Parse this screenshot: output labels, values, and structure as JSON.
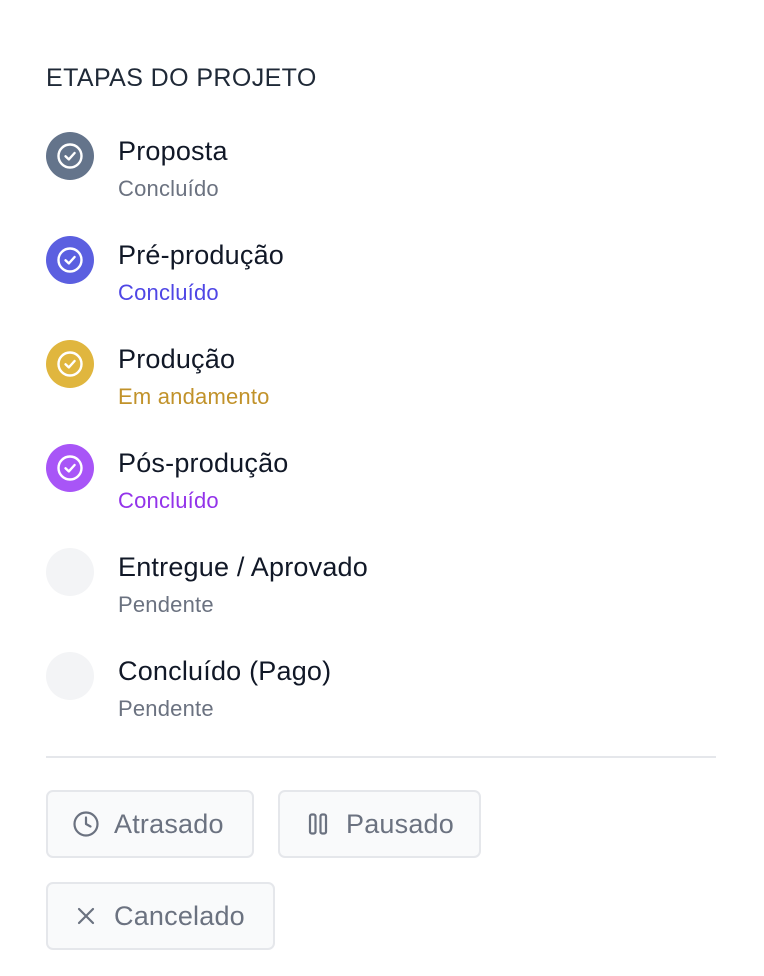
{
  "heading": "ETAPAS DO PROJETO",
  "steps": [
    {
      "title": "Proposta",
      "status": "Concluído",
      "icon": "check-circle-icon",
      "circle_color": "#64748b",
      "status_color": "#6b7280",
      "done": true
    },
    {
      "title": "Pré-produção",
      "status": "Concluído",
      "icon": "check-circle-icon",
      "circle_color": "#5b5fe0",
      "status_color": "#4f46e5",
      "done": true
    },
    {
      "title": "Produção",
      "status": "Em andamento",
      "icon": "check-circle-icon",
      "circle_color": "#e0b63e",
      "status_color": "#c1922a",
      "done": true
    },
    {
      "title": "Pós-produção",
      "status": "Concluído",
      "icon": "check-circle-icon",
      "circle_color": "#a855f7",
      "status_color": "#9333ea",
      "done": true
    },
    {
      "title": "Entregue / Aprovado",
      "status": "Pendente",
      "icon": "",
      "circle_color": "#f3f4f6",
      "status_color": "#6b7280",
      "done": false
    },
    {
      "title": "Concluído (Pago)",
      "status": "Pendente",
      "icon": "",
      "circle_color": "#f3f4f6",
      "status_color": "#6b7280",
      "done": false
    }
  ],
  "actions": {
    "delayed": {
      "label": "Atrasado",
      "icon": "clock-icon"
    },
    "paused": {
      "label": "Pausado",
      "icon": "pause-icon"
    },
    "cancelled": {
      "label": "Cancelado",
      "icon": "close-icon"
    }
  }
}
